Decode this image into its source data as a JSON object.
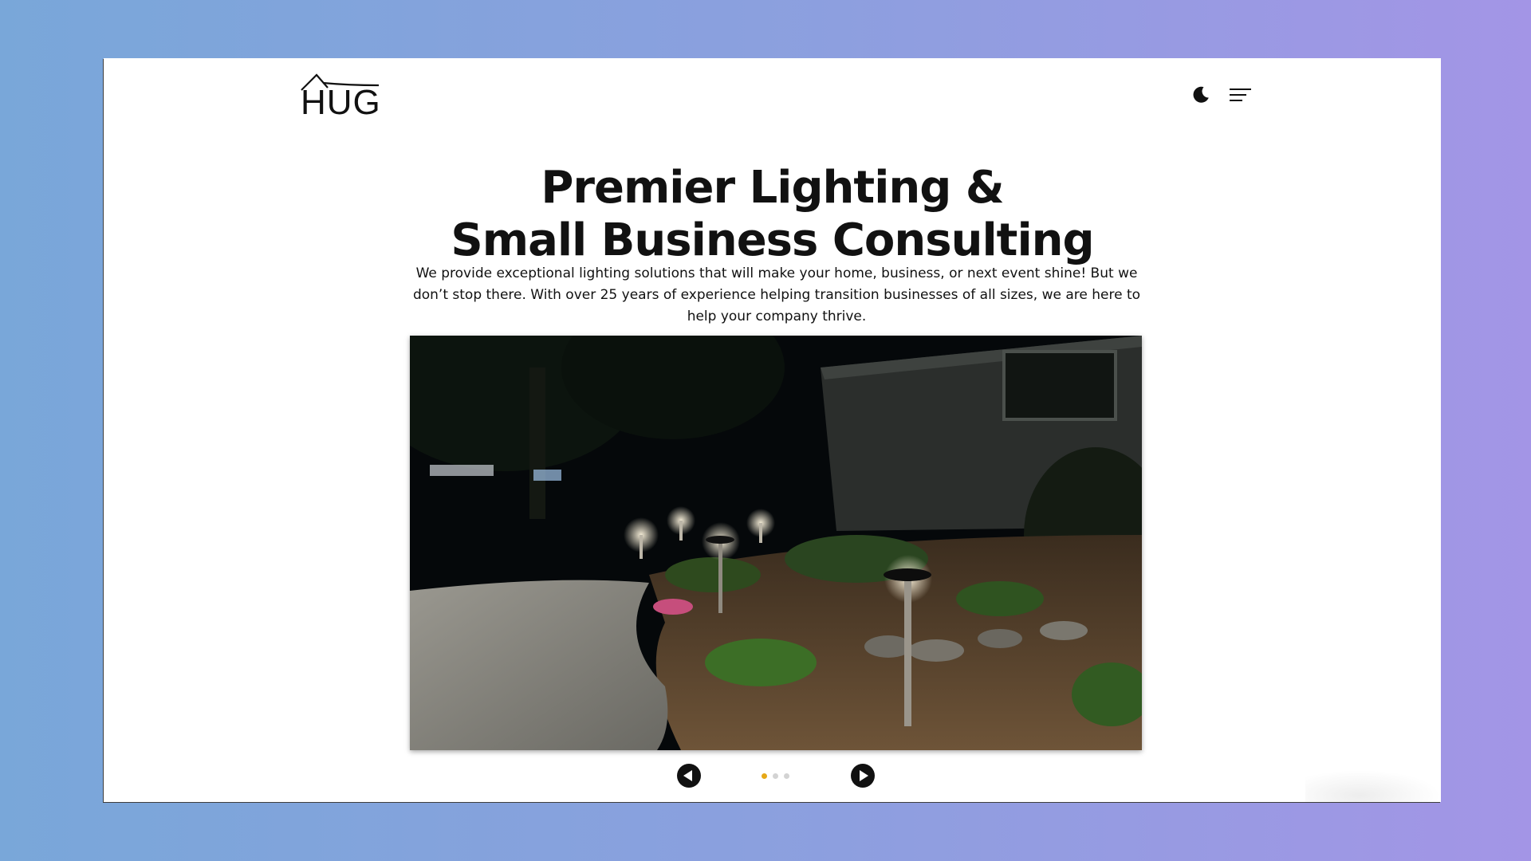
{
  "brand": {
    "logo_text": "HUG"
  },
  "header": {
    "theme_toggle_icon": "moon-icon",
    "menu_icon": "hamburger-menu-icon"
  },
  "hero": {
    "title_line1": "Premier Lighting &",
    "title_line2": "Small Business Consulting",
    "description": "We provide exceptional lighting solutions that will make your home, business, or next event shine! But we don’t stop there. With over 25 years of experience helping transition businesses of all sizes, we are here to help your company thrive."
  },
  "carousel": {
    "prev_icon": "arrow-left-icon",
    "next_icon": "arrow-right-icon",
    "slide_count": 3,
    "active_slide": 1,
    "colors": {
      "active_dot": "#e6a817",
      "inactive_dot": "#d3d3d3"
    }
  }
}
